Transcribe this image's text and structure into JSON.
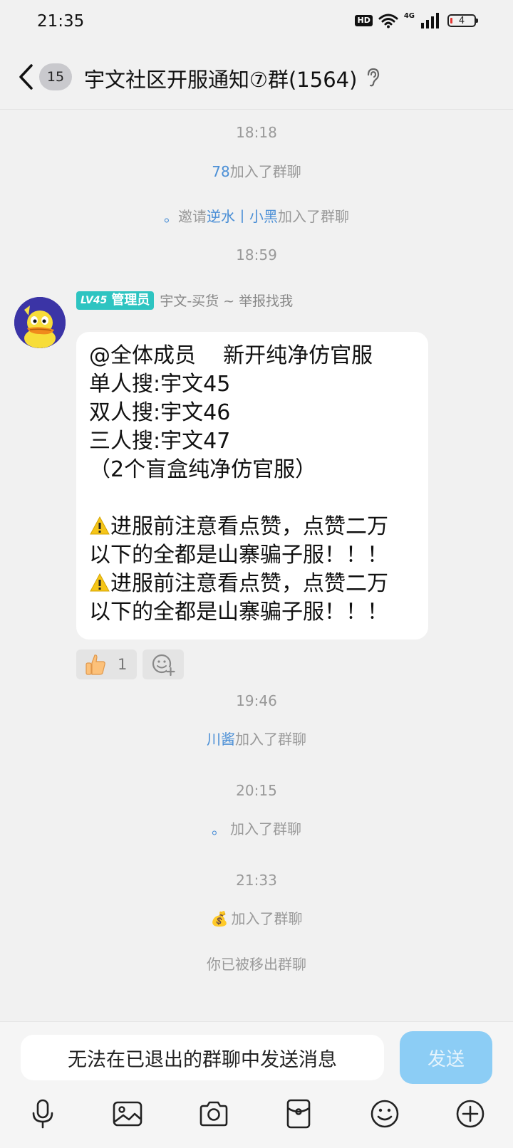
{
  "status_bar": {
    "time": "21:35",
    "hd": "HD",
    "network": "4G",
    "battery": "4"
  },
  "header": {
    "unread_count": "15",
    "title": "宇文社区开服通知⑦群(1564)"
  },
  "chat": {
    "time_1": "18:18",
    "join_1_user": "78",
    "join_1_text": "加入了群聊",
    "invite_prefix_dot": "。",
    "invite_word": "邀请",
    "invite_user": "逆水丨小黑",
    "invite_suffix": "加入了群聊",
    "time_2": "18:59",
    "sender": {
      "level": "LV45",
      "role": "管理员",
      "name": "宇文-买货 ~ 举报找我"
    },
    "message_lines": [
      "@全体成员    新开纯净仿官服",
      "单人搜:宇文45",
      "双人搜:宇文46",
      "三人搜:宇文47",
      "（2个盲盒纯净仿官服）",
      "",
      "进服前注意看点赞，点赞二万",
      "以下的全都是山寨骗子服！！！",
      "进服前注意看点赞，点赞二万",
      "以下的全都是山寨骗子服！！！"
    ],
    "reaction_count": "1",
    "time_3": "19:46",
    "join_3_user": "川酱",
    "join_3_text": "加入了群聊",
    "time_4": "20:15",
    "join_4_user": "。",
    "join_4_text": "加入了群聊",
    "time_5": "21:33",
    "join_5_user": "💰",
    "join_5_text": "加入了群聊",
    "removed_notice": "你已被移出群聊"
  },
  "composer": {
    "placeholder": "无法在已退出的群聊中发送消息",
    "send_label": "发送"
  },
  "colors": {
    "link": "#4b8fd6",
    "send_disabled": "#8ccdf5",
    "admin_badge": "#2ec4c1"
  }
}
